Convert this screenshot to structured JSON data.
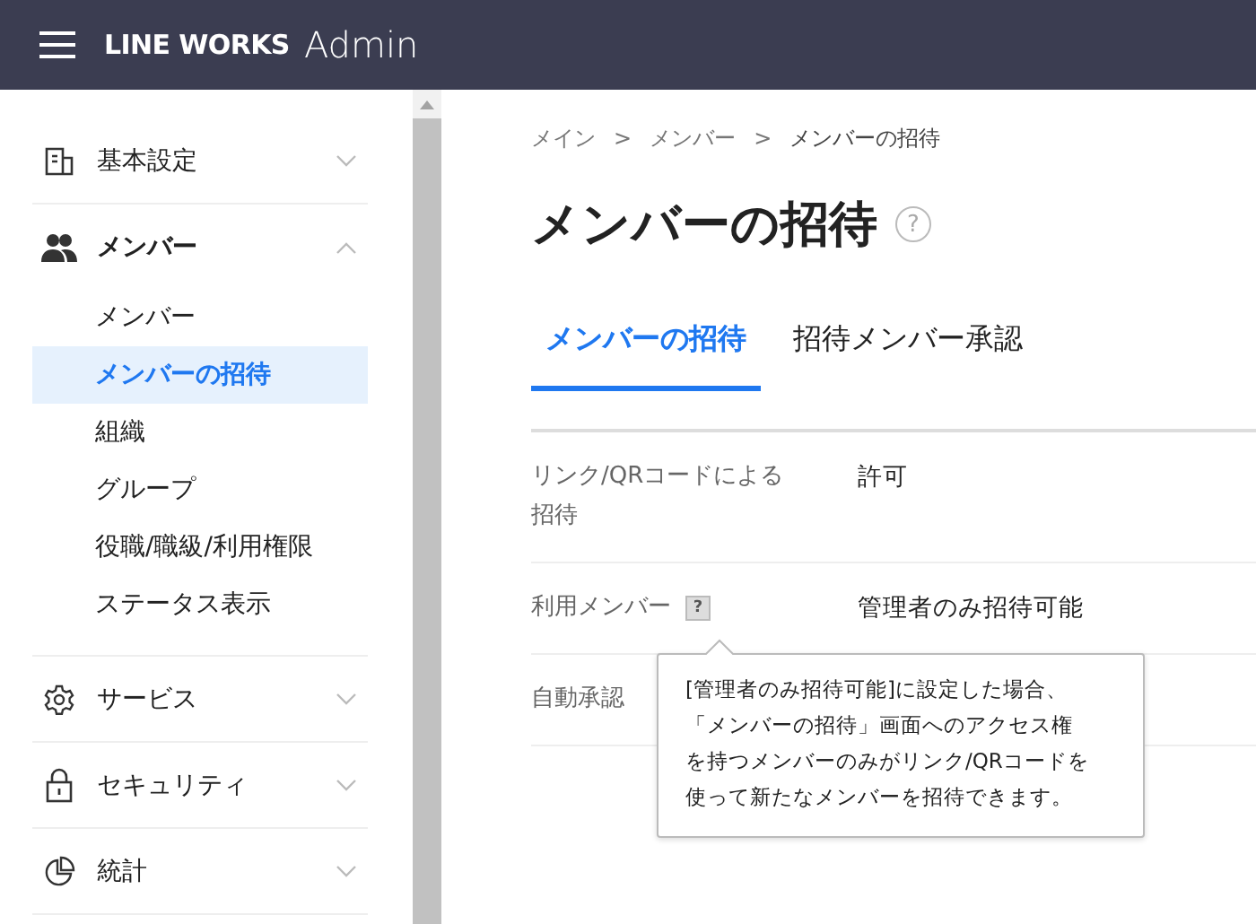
{
  "header": {
    "brand": "LINE WORKS",
    "product": "Admin"
  },
  "sidebar": {
    "items": [
      {
        "label": "基本設定",
        "expanded": false
      },
      {
        "label": "メンバー",
        "expanded": true,
        "children": [
          {
            "label": "メンバー",
            "selected": false
          },
          {
            "label": "メンバーの招待",
            "selected": true
          },
          {
            "label": "組織",
            "selected": false
          },
          {
            "label": "グループ",
            "selected": false
          },
          {
            "label": "役職/職級/利用権限",
            "selected": false
          },
          {
            "label": "ステータス表示",
            "selected": false
          }
        ]
      },
      {
        "label": "サービス",
        "expanded": false
      },
      {
        "label": "セキュリティ",
        "expanded": false
      },
      {
        "label": "統計",
        "expanded": false
      }
    ]
  },
  "breadcrumb": [
    "メイン",
    "メンバー",
    "メンバーの招待"
  ],
  "breadcrumb_separator": ">",
  "page_title": "メンバーの招待",
  "help_mark": "?",
  "tabs": [
    {
      "label": "メンバーの招待",
      "selected": true
    },
    {
      "label": "招待メンバー承認",
      "selected": false
    }
  ],
  "settings": [
    {
      "label": "リンク/QRコードによる招待",
      "value": "許可",
      "help": false
    },
    {
      "label": "利用メンバー",
      "value": "管理者のみ招待可能",
      "help": true
    },
    {
      "label": "自動承認",
      "help": false
    }
  ],
  "tooltip": "[管理者のみ招待可能]に設定した場合、「メンバーの招待」画面へのアクセス権を持つメンバーのみがリンク/QRコードを使って新たなメンバーを招待できます。"
}
